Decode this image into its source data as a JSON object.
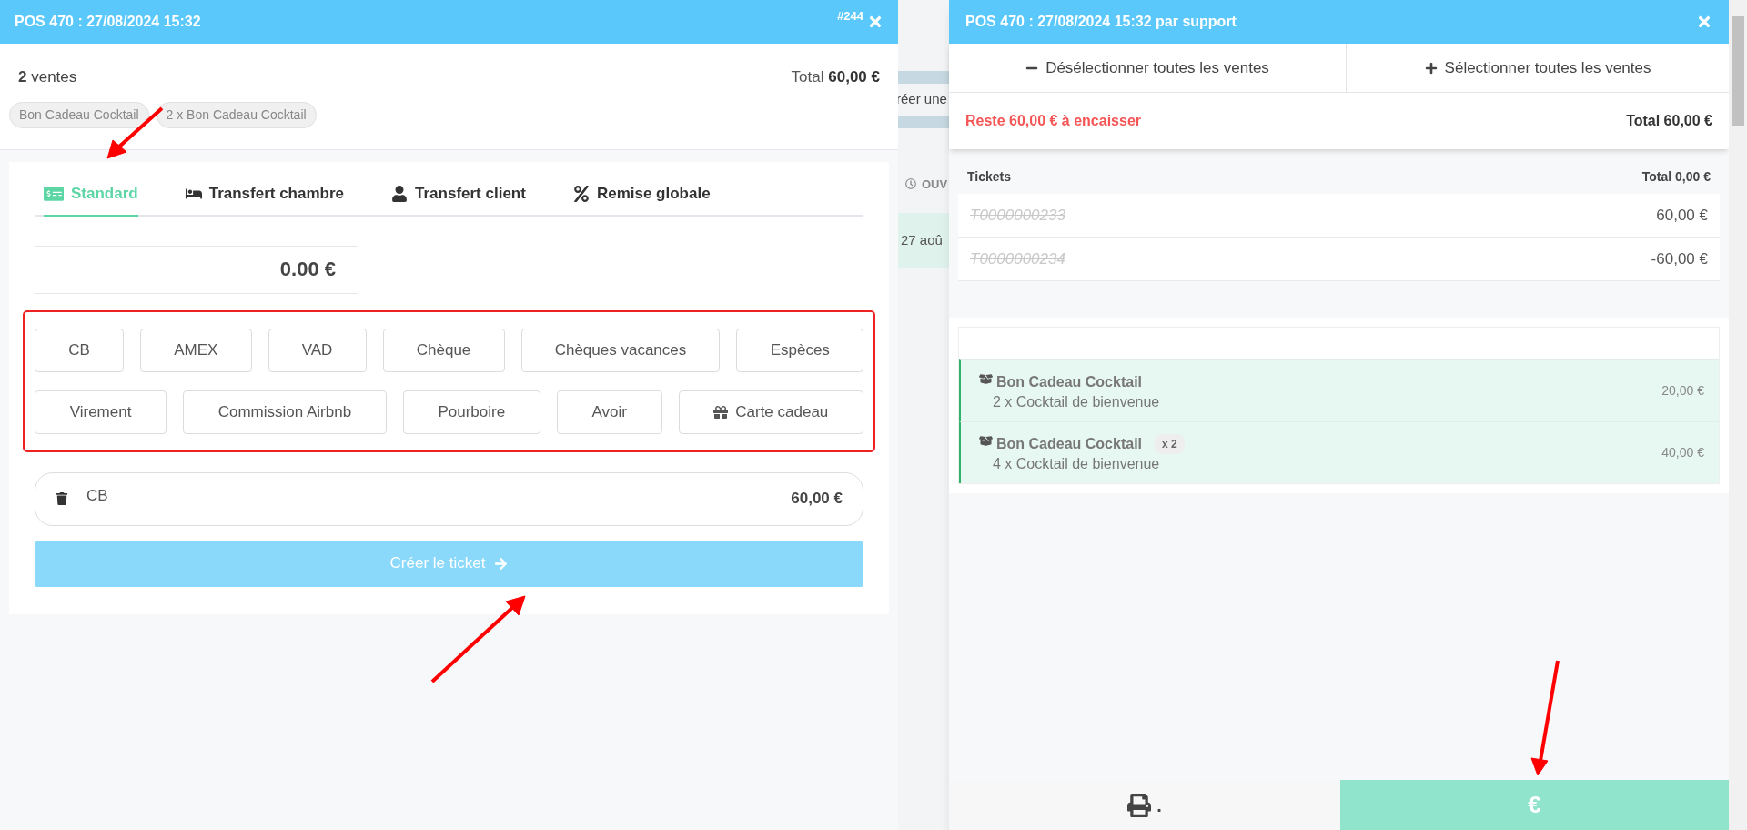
{
  "left_panel": {
    "title": "POS 470 : 27/08/2024 15:32",
    "ref": "#244",
    "sales_count": "2",
    "sales_label": "ventes",
    "total_label": "Total",
    "total_value": "60,00 €",
    "chips": [
      "Bon Cadeau Cocktail",
      "2 x Bon Cadeau Cocktail"
    ],
    "tabs": [
      {
        "label": "Standard",
        "kind": "card",
        "selected": true
      },
      {
        "label": "Transfert chambre",
        "kind": "bed",
        "selected": false
      },
      {
        "label": "Transfert client",
        "kind": "user",
        "selected": false
      },
      {
        "label": "Remise globale",
        "kind": "percent",
        "selected": false
      }
    ],
    "amount_field": {
      "value": "0.00 €"
    },
    "payment_methods": [
      [
        {
          "label": "CB",
          "kind": "plain"
        },
        {
          "label": "AMEX",
          "kind": "plain"
        },
        {
          "label": "VAD",
          "kind": "plain"
        },
        {
          "label": "Chèque",
          "kind": "plain"
        },
        {
          "label": "Chèques vacances",
          "kind": "plain"
        },
        {
          "label": "Espèces",
          "kind": "plain"
        }
      ],
      [
        {
          "label": "Virement",
          "kind": "plain"
        },
        {
          "label": "Commission Airbnb",
          "kind": "plain"
        },
        {
          "label": "Pourboire",
          "kind": "plain"
        },
        {
          "label": "Avoir",
          "kind": "plain"
        },
        {
          "label": "Carte cadeau",
          "kind": "gift"
        }
      ]
    ],
    "payments": [
      {
        "method": "CB",
        "amount": "60,00 €"
      }
    ],
    "create_button": {
      "label": "Créer le ticket",
      "disabled": true
    }
  },
  "background": {
    "texts": [
      "réer une",
      "OUV",
      "27 aoû"
    ]
  },
  "right_panel": {
    "title": "POS 470 : 27/08/2024 15:32 par support",
    "deselect_all": "Désélectionner toutes les ventes",
    "select_all": "Sélectionner toutes les ventes",
    "remaining": "Reste 60,00 € à encaisser",
    "total": "Total 60,00 €",
    "tickets_label": "Tickets",
    "tickets_total": "Total 0,00 €",
    "tickets": [
      {
        "number": "T0000000233",
        "amount": "60,00 €",
        "cancelled": true
      },
      {
        "number": "T0000000234",
        "amount": "-60,00 €",
        "cancelled": true
      }
    ],
    "sales": [
      {
        "name": "Bon Cadeau Cocktail",
        "detail": "2 x Cocktail de bienvenue",
        "amount": "20,00 €",
        "selected": true
      },
      {
        "name": "Bon Cadeau Cocktail",
        "badge": "x 2",
        "detail": "4 x Cocktail de bienvenue",
        "amount": "40,00 €",
        "selected": true
      }
    ],
    "print_label": ".",
    "pay_label": "€"
  }
}
